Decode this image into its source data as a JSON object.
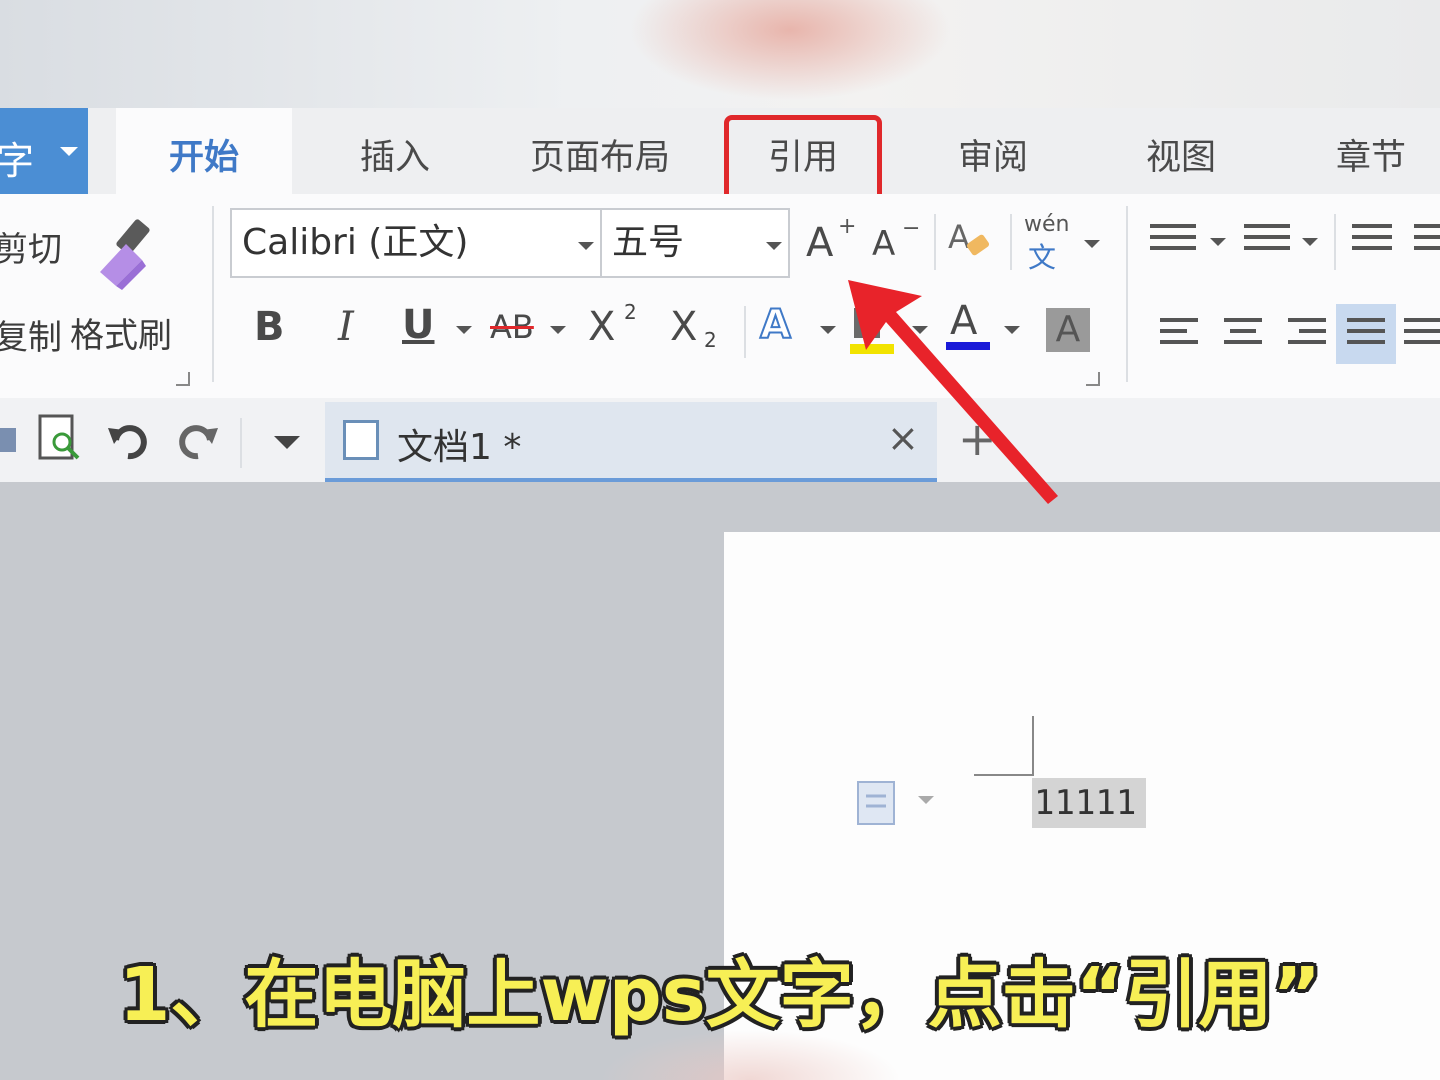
{
  "app": {
    "button_label": "字"
  },
  "tabs": [
    {
      "label": "开始",
      "active": true
    },
    {
      "label": "插入"
    },
    {
      "label": "页面布局"
    },
    {
      "label": "引用",
      "highlighted": true
    },
    {
      "label": "审阅"
    },
    {
      "label": "视图"
    },
    {
      "label": "章节"
    }
  ],
  "clipboard": {
    "cut_label": "剪切",
    "copy_label": "复制",
    "format_painter_label": "格式刷"
  },
  "font": {
    "family_value": "Calibri (正文)",
    "size_value": "五号",
    "grow_label": "A",
    "shrink_label": "A",
    "phonetic_top": "wén",
    "phonetic_bottom": "文"
  },
  "format_buttons": {
    "bold": "B",
    "italic": "I",
    "underline": "U",
    "strike": "AB",
    "superscript": "X",
    "sup_mark": "2",
    "subscript": "X",
    "sub_mark": "2",
    "text_effect": "A",
    "font_color": "A",
    "char_shading": "A"
  },
  "document_tab": {
    "title": "文档1 *",
    "close": "×",
    "new_tab": "+"
  },
  "document": {
    "body_text": "11111"
  },
  "caption": "1、在电脑上wps文字，点击“引用”",
  "colors": {
    "accent": "#3f79c7",
    "highlight": "#e0282b",
    "caption": "#f7ef55"
  }
}
